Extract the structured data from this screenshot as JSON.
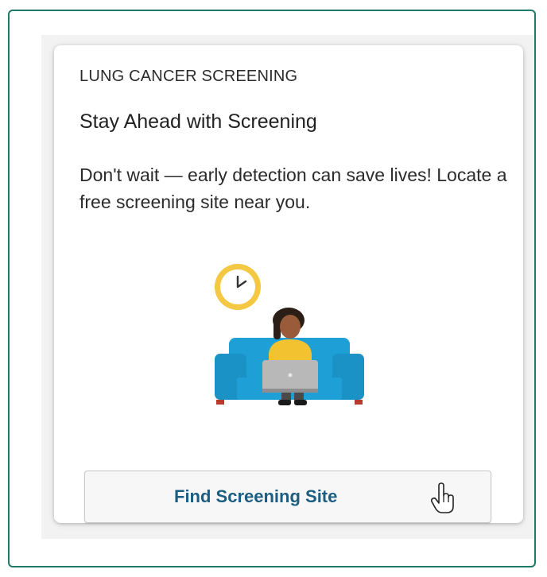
{
  "card": {
    "eyebrow": "LUNG CANCER SCREENING",
    "title": "Stay Ahead with Screening",
    "description": "Don't wait — early detection can save lives! Locate a free screening site near you.",
    "button_label": "Find Screening Site"
  },
  "colors": {
    "frame_border": "#1f7a68",
    "button_text": "#1b5e82",
    "sofa": "#1e9fd6",
    "clock": "#f4c842",
    "shirt": "#f2c230",
    "laptop": "#b8b8b8"
  },
  "icons": {
    "illustration": "woman-on-sofa-with-laptop-illustration",
    "clock": "clock-icon",
    "cursor": "hand-pointer-cursor-icon"
  }
}
